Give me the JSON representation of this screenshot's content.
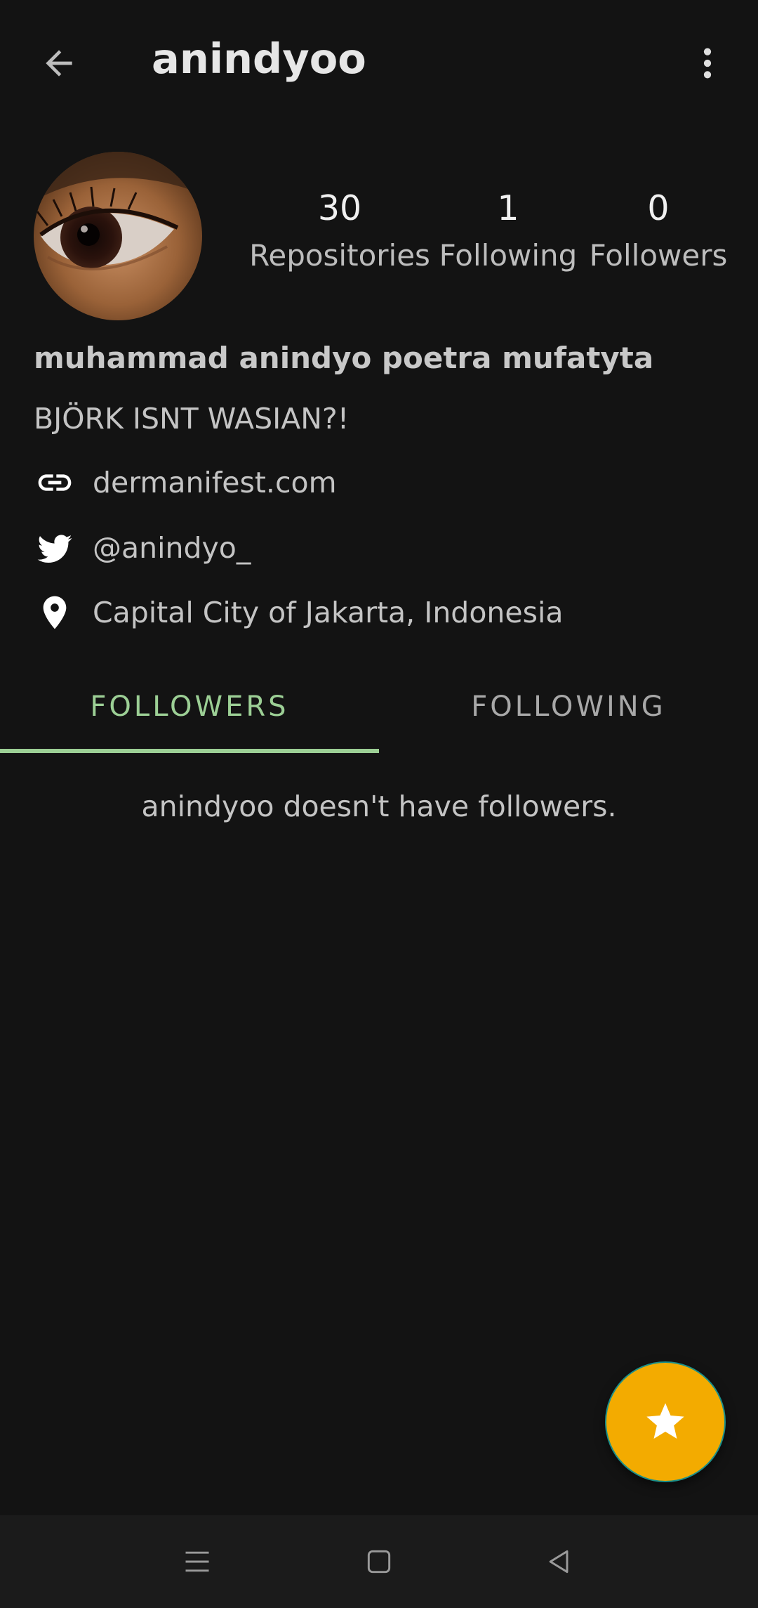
{
  "appbar": {
    "title": "anindyoo",
    "back_icon": "arrow-back-icon",
    "more_icon": "more-vert-icon"
  },
  "profile": {
    "avatar_description": "eye-photo",
    "stats": [
      {
        "value": "30",
        "label": "Repositories"
      },
      {
        "value": "1",
        "label": "Following"
      },
      {
        "value": "0",
        "label": "Followers"
      }
    ],
    "full_name": "muhammad anindyo poetra mufatyta",
    "bio": "BJÖRK ISNT WASIAN?!",
    "website": "dermanifest.com",
    "twitter": "@anindyo_",
    "location": "Capital City of Jakarta, Indonesia"
  },
  "tabs": [
    {
      "label": "FOLLOWERS",
      "active": true
    },
    {
      "label": "FOLLOWING",
      "active": false
    }
  ],
  "empty_message": "anindyoo doesn't have followers.",
  "fab": {
    "icon": "star-icon"
  },
  "navbar": {
    "items": [
      "menu-icon",
      "home-square-icon",
      "back-triangle-icon"
    ]
  },
  "colors": {
    "background": "#131313",
    "accent_tab": "#9ccf95",
    "fab": "#f3ab00",
    "navbar": "#1b1b1b"
  }
}
